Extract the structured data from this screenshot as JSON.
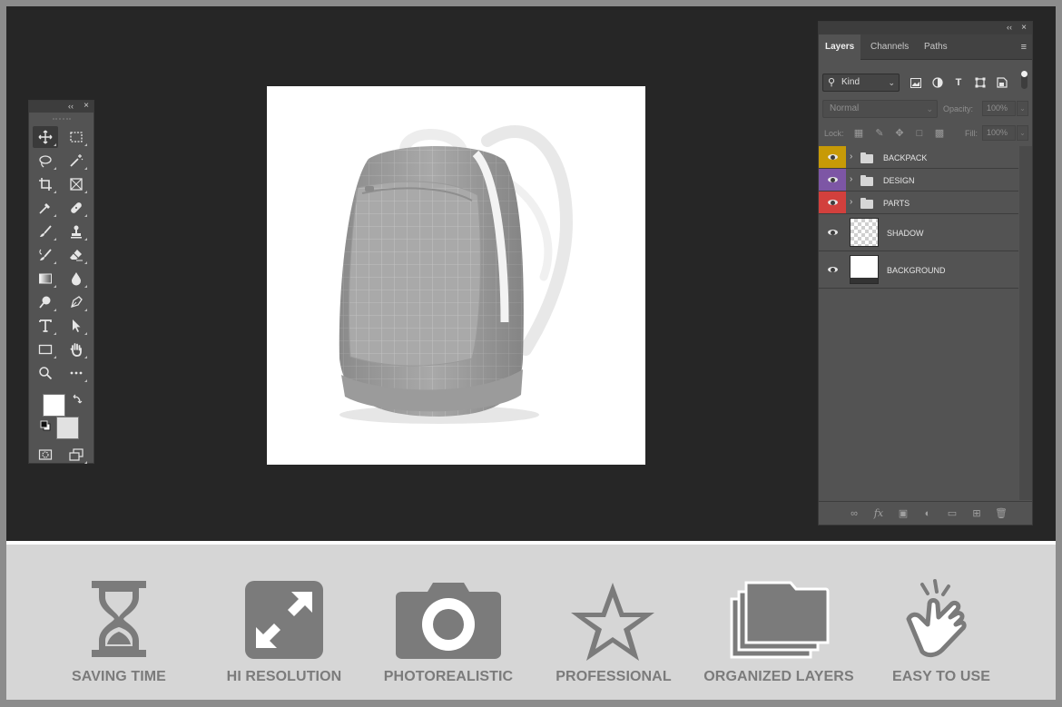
{
  "toolbox": {
    "collapse": "‹‹",
    "close": "×"
  },
  "layers_panel": {
    "collapse": "‹‹",
    "close": "×",
    "tabs": [
      "Layers",
      "Channels",
      "Paths"
    ],
    "menu_icon": "≡",
    "filter": {
      "kind": "Kind"
    },
    "blend_mode": "Normal",
    "opacity_label": "Opacity:",
    "opacity_value": "100%",
    "lock_label": "Lock:",
    "fill_label": "Fill:",
    "fill_value": "100%",
    "layers": [
      {
        "name": "BACKPACK",
        "type": "group",
        "color": "#c79a07"
      },
      {
        "name": "DESIGN",
        "type": "group",
        "color": "#7d56a5"
      },
      {
        "name": "PARTS",
        "type": "group",
        "color": "#d2403d"
      },
      {
        "name": "SHADOW",
        "type": "layer",
        "thumb": "checker"
      },
      {
        "name": "BACKGROUND",
        "type": "layer",
        "thumb": "white"
      }
    ]
  },
  "features": [
    {
      "label": "SAVING TIME",
      "icon": "hourglass-icon"
    },
    {
      "label": "HI RESOLUTION",
      "icon": "expand-arrows-icon"
    },
    {
      "label": "PHOTOREALISTIC",
      "icon": "camera-icon"
    },
    {
      "label": "PROFESSIONAL",
      "icon": "star-icon"
    },
    {
      "label": "ORGANIZED LAYERS",
      "icon": "stacked-folders-icon"
    },
    {
      "label": "EASY TO USE",
      "icon": "pointing-hand-icon"
    }
  ],
  "colors": {
    "workspace": "#262626",
    "panel": "#535353",
    "feature_bar": "#d6d6d6",
    "feature_icon": "#7b7b7b"
  }
}
